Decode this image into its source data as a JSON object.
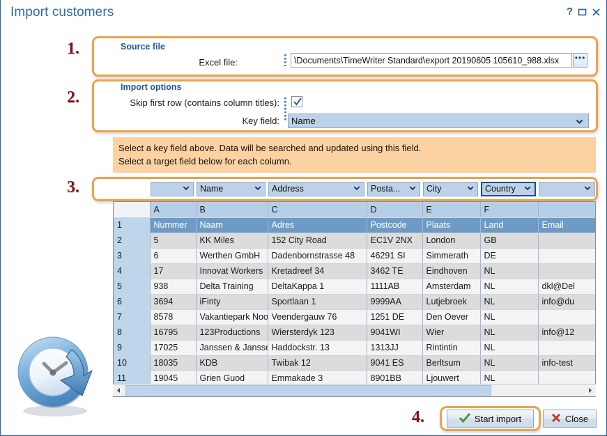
{
  "window": {
    "title": "Import customers",
    "buttons": {
      "help": "?",
      "maximize": "maximize-icon",
      "close": "close-icon"
    }
  },
  "steps": {
    "one": "1.",
    "two": "2.",
    "three": "3.",
    "four": "4."
  },
  "source_file": {
    "group_title": "Source file",
    "excel_label": "Excel file:",
    "excel_value": "\\Documents\\TimeWriter Standard\\export 20190605 105610_988.xlsx",
    "browse_label": "•••"
  },
  "import_options": {
    "group_title": "Import options",
    "skip_label": "Skip first row (contains column titles):",
    "skip_checked": true,
    "key_field_label": "Key field:",
    "key_field_value": "Name"
  },
  "info_banner": {
    "line1": "Select a key field above. Data will be searched and updated using this field.",
    "line2": "Select a target field below for each column."
  },
  "mapping": {
    "columns": [
      {
        "name": "map-select-gutter",
        "value": "",
        "blank": true,
        "focused": false,
        "hidden": true
      },
      {
        "name": "map-select-a",
        "value": "",
        "blank": false,
        "focused": false
      },
      {
        "name": "map-select-b",
        "value": "Name",
        "blank": false,
        "focused": false
      },
      {
        "name": "map-select-c",
        "value": "Address",
        "blank": false,
        "focused": false
      },
      {
        "name": "map-select-d",
        "value": "Posta...",
        "blank": false,
        "focused": false
      },
      {
        "name": "map-select-e",
        "value": "City",
        "blank": false,
        "focused": false
      },
      {
        "name": "map-select-f",
        "value": "Country",
        "blank": false,
        "focused": true
      },
      {
        "name": "map-select-g",
        "value": "",
        "blank": false,
        "focused": false
      }
    ]
  },
  "grid": {
    "column_headers": [
      "",
      "A",
      "B",
      "C",
      "D",
      "E",
      "F",
      ""
    ],
    "rows": [
      {
        "num": "1",
        "cells": [
          "Nummer",
          "Naam",
          "Adres",
          "Postcode",
          "Plaats",
          "Land",
          "Email"
        ]
      },
      {
        "num": "2",
        "cells": [
          "5",
          "KK Miles",
          "152 City Road",
          "EC1V 2NX",
          "London",
          "GB",
          ""
        ]
      },
      {
        "num": "3",
        "cells": [
          "6",
          "Werthen GmbH",
          "Dadenbornstrasse 48",
          "46291 SI",
          "Simmerath",
          "DE",
          ""
        ]
      },
      {
        "num": "4",
        "cells": [
          "17",
          "Innovat Workers",
          "Kretadreef 34",
          "3462 TE",
          "Eindhoven",
          "NL",
          ""
        ]
      },
      {
        "num": "5",
        "cells": [
          "938",
          "Delta Training",
          "DeltaKappa 1",
          "1111AB",
          "Amsterdam",
          "NL",
          "dkl@Del"
        ]
      },
      {
        "num": "6",
        "cells": [
          "3694",
          "iFinty",
          "Sportlaan 1",
          "9999AA",
          "Lutjebroek",
          "NL",
          "info@du"
        ]
      },
      {
        "num": "7",
        "cells": [
          "8578",
          "Vakantiepark Noord",
          "Veendergauw 76",
          "1251 DE",
          "Den Oever",
          "NL",
          ""
        ]
      },
      {
        "num": "8",
        "cells": [
          "16795",
          "123Productions",
          "Wiersterdyk 123",
          "9041WI",
          "Wier",
          "NL",
          "info@12"
        ]
      },
      {
        "num": "9",
        "cells": [
          "17025",
          "Janssen & Janssen",
          "Haddockstr. 13",
          "1313JJ",
          "Rintintin",
          "NL",
          ""
        ]
      },
      {
        "num": "10",
        "cells": [
          "18035",
          "KDB",
          "Twibak 12",
          "9041 ES",
          "Berltsum",
          "NL",
          "info-test"
        ]
      },
      {
        "num": "11",
        "cells": [
          "19045",
          "Grien Guod",
          "Emmakade 3",
          "8901BB",
          "Ljouwert",
          "NL",
          ""
        ]
      }
    ]
  },
  "footer": {
    "start_label": "Start import",
    "close_label": "Close"
  },
  "colors": {
    "accent_orange": "#eda24b",
    "title_blue": "#2d6da3",
    "banner_orange": "#fcd2a2",
    "step_red": "#7d1418",
    "header_blue": "#b6cfe8",
    "title_row_blue": "#6e9bc5"
  }
}
